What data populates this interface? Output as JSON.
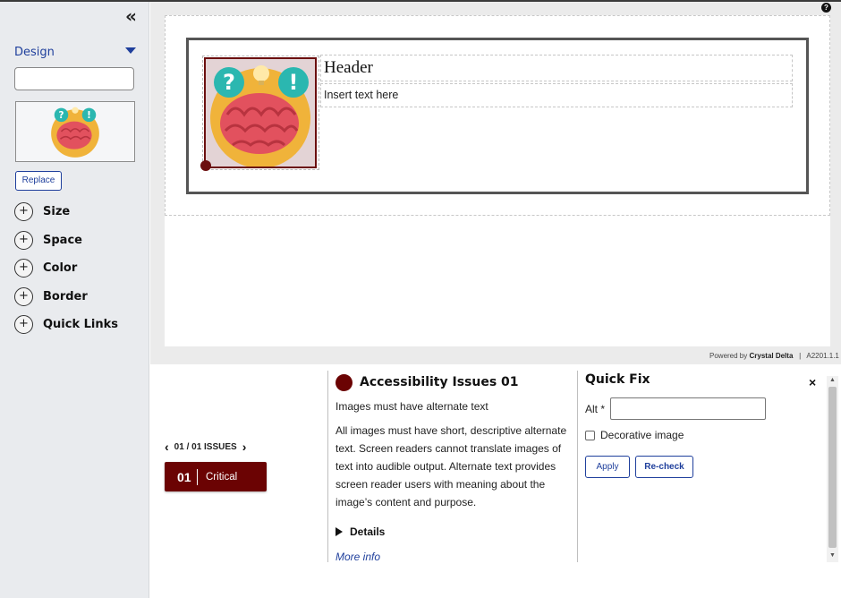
{
  "sidebar": {
    "collapse_glyph": "«",
    "design_label": "Design",
    "design_input_value": "",
    "replace_label": "Replace",
    "sections": [
      {
        "label": "Size"
      },
      {
        "label": "Space"
      },
      {
        "label": "Color"
      },
      {
        "label": "Border"
      },
      {
        "label": "Quick Links"
      }
    ]
  },
  "canvas": {
    "help_glyph": "?",
    "header_text": "Header",
    "body_text": "Insert text here",
    "powered_prefix": "Powered by",
    "powered_brand": "Crystal Delta",
    "version": "A2201.1.1"
  },
  "issues": {
    "count_text": "01 / 01 ISSUES",
    "items": [
      {
        "number": "01",
        "severity": "Critical"
      }
    ],
    "detail": {
      "title": "Accessibility Issues 01",
      "subtitle": "Images must have alternate text",
      "description": "All images must have short, descriptive alternate text. Screen readers cannot translate images of text into audible output. Alternate text provides screen reader users with meaning about the image’s content and purpose.",
      "details_label": "Details",
      "more_info_label": "More info"
    },
    "quick_fix": {
      "title": "Quick Fix",
      "alt_label": "Alt *",
      "alt_value": "",
      "decorative_label": "Decorative image",
      "decorative_checked": false,
      "apply_label": "Apply",
      "recheck_label": "Re-check",
      "close_glyph": "×"
    }
  },
  "colors": {
    "accent_blue": "#1f3f9c",
    "critical": "#6b0303",
    "image_bg": "#e8a83a",
    "brain": "#e05060",
    "question_bubble": "#2bb7b0"
  }
}
